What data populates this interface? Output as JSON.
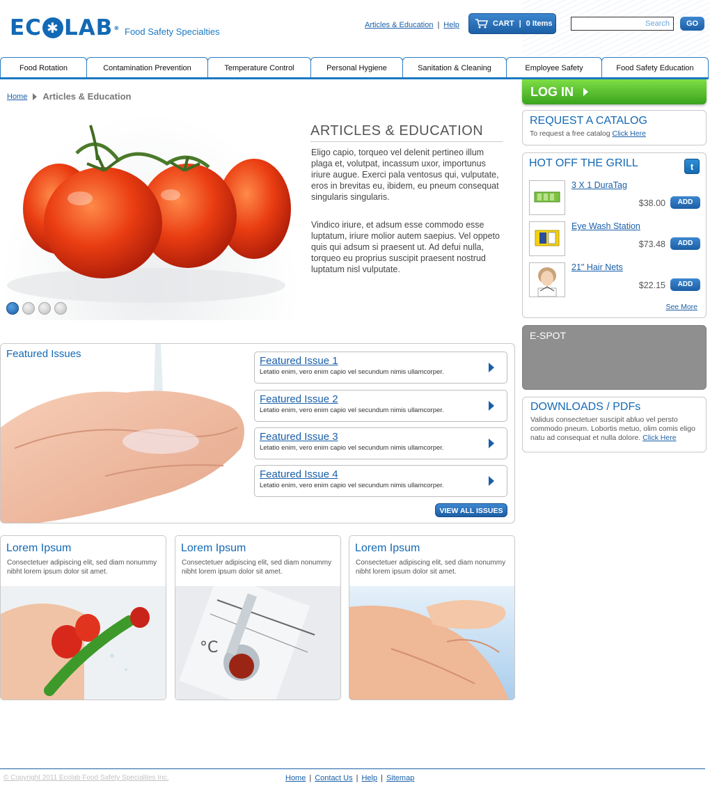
{
  "header": {
    "logo_text_left": "EC",
    "logo_text_right": "LAB",
    "logo_mark": "®",
    "tagline": "Food Safety Specialties",
    "top_links": [
      "Articles & Education",
      "Help"
    ],
    "cart_label": "CART",
    "cart_items": "0 Items",
    "search_placeholder": "Search",
    "go_label": "GO"
  },
  "nav": {
    "tabs": [
      "Food Rotation",
      "Contamination Prevention",
      "Temperature Control",
      "Personal Hygiene",
      "Sanitation & Cleaning",
      "Employee Safety",
      "Food Safety Education"
    ]
  },
  "breadcrumb": {
    "home": "Home",
    "current": "Articles & Education"
  },
  "hero": {
    "title": "ARTICLES & EDUCATION",
    "paragraph_1": "Eligo capio, torqueo vel delenit pertineo illum plaga et, volutpat, incassum uxor, importunus iriure augue. Exerci pala ventosus qui, vulputate, eros in brevitas eu, ibidem, eu pneum consequat singularis singularis.",
    "paragraph_2": "Vindico iriure, et adsum esse commodo esse luptatum, iriure molior autem saepius. Vel oppeto quis qui adsum si praesent ut. Ad defui nulla, torqueo eu proprius suscipit praesent nostrud luptatum nisl vulputate.",
    "slide_count": 4,
    "active_slide": 1
  },
  "sidebar": {
    "login_label": "LOG IN",
    "catalog": {
      "title": "REQUEST A CATALOG",
      "text": "To request a free catalog",
      "link": "Click Here"
    },
    "grill": {
      "title": "HOT OFF THE GRILL",
      "twitter_glyph": "t",
      "products": [
        {
          "name": "3 X 1 DuraTag",
          "price": "$38.00",
          "add": "ADD"
        },
        {
          "name": "Eye Wash Station",
          "price": "$73.48",
          "add": "ADD"
        },
        {
          "name": "21\" Hair Nets",
          "price": "$22.15",
          "add": "ADD"
        }
      ],
      "see_more": "See More"
    },
    "espot": {
      "title": "E-SPOT"
    },
    "downloads": {
      "title": "DOWNLOADS / PDFs",
      "text": "Validus consectetuer suscipit abluo vel persto commodo pneum. Lobortis metuo, olim comis eligo natu ad consequat et nulla dolore.",
      "link": "Click Here"
    }
  },
  "featured": {
    "title": "Featured Issues",
    "issues": [
      {
        "title": "Featured Issue 1",
        "desc": "Letatio enim, vero enim capio vel secundum nimis ullamcorper."
      },
      {
        "title": "Featured Issue 2",
        "desc": "Letatio enim, vero enim capio vel secundum nimis ullamcorper."
      },
      {
        "title": "Featured Issue 3",
        "desc": "Letatio enim, vero enim capio vel secundum nimis ullamcorper."
      },
      {
        "title": "Featured Issue 4",
        "desc": "Letatio enim, vero enim capio vel secundum nimis ullamcorper."
      }
    ],
    "view_all": "VIEW ALL ISSUES"
  },
  "cards": [
    {
      "title": "Lorem Ipsum",
      "text": "Consectetuer adipiscing elit, sed diam nonummy nibht lorem ipsum dolor sit amet."
    },
    {
      "title": "Lorem Ipsum",
      "text": "Consectetuer adipiscing elit, sed diam nonummy nibht lorem ipsum dolor sit amet."
    },
    {
      "title": "Lorem Ipsum",
      "text": "Consectetuer adipiscing elit, sed diam nonummy nibht lorem ipsum dolor sit amet."
    }
  ],
  "footer": {
    "copyright": "© Copyright 2011 Ecolab Food Safety Specialties Inc.",
    "links": [
      "Home",
      "Contact Us",
      "Help",
      "Sitemap"
    ]
  },
  "colors": {
    "brand_blue": "#1269b5",
    "login_green": "#4cb526",
    "espot_gray": "#8f8f8f"
  }
}
